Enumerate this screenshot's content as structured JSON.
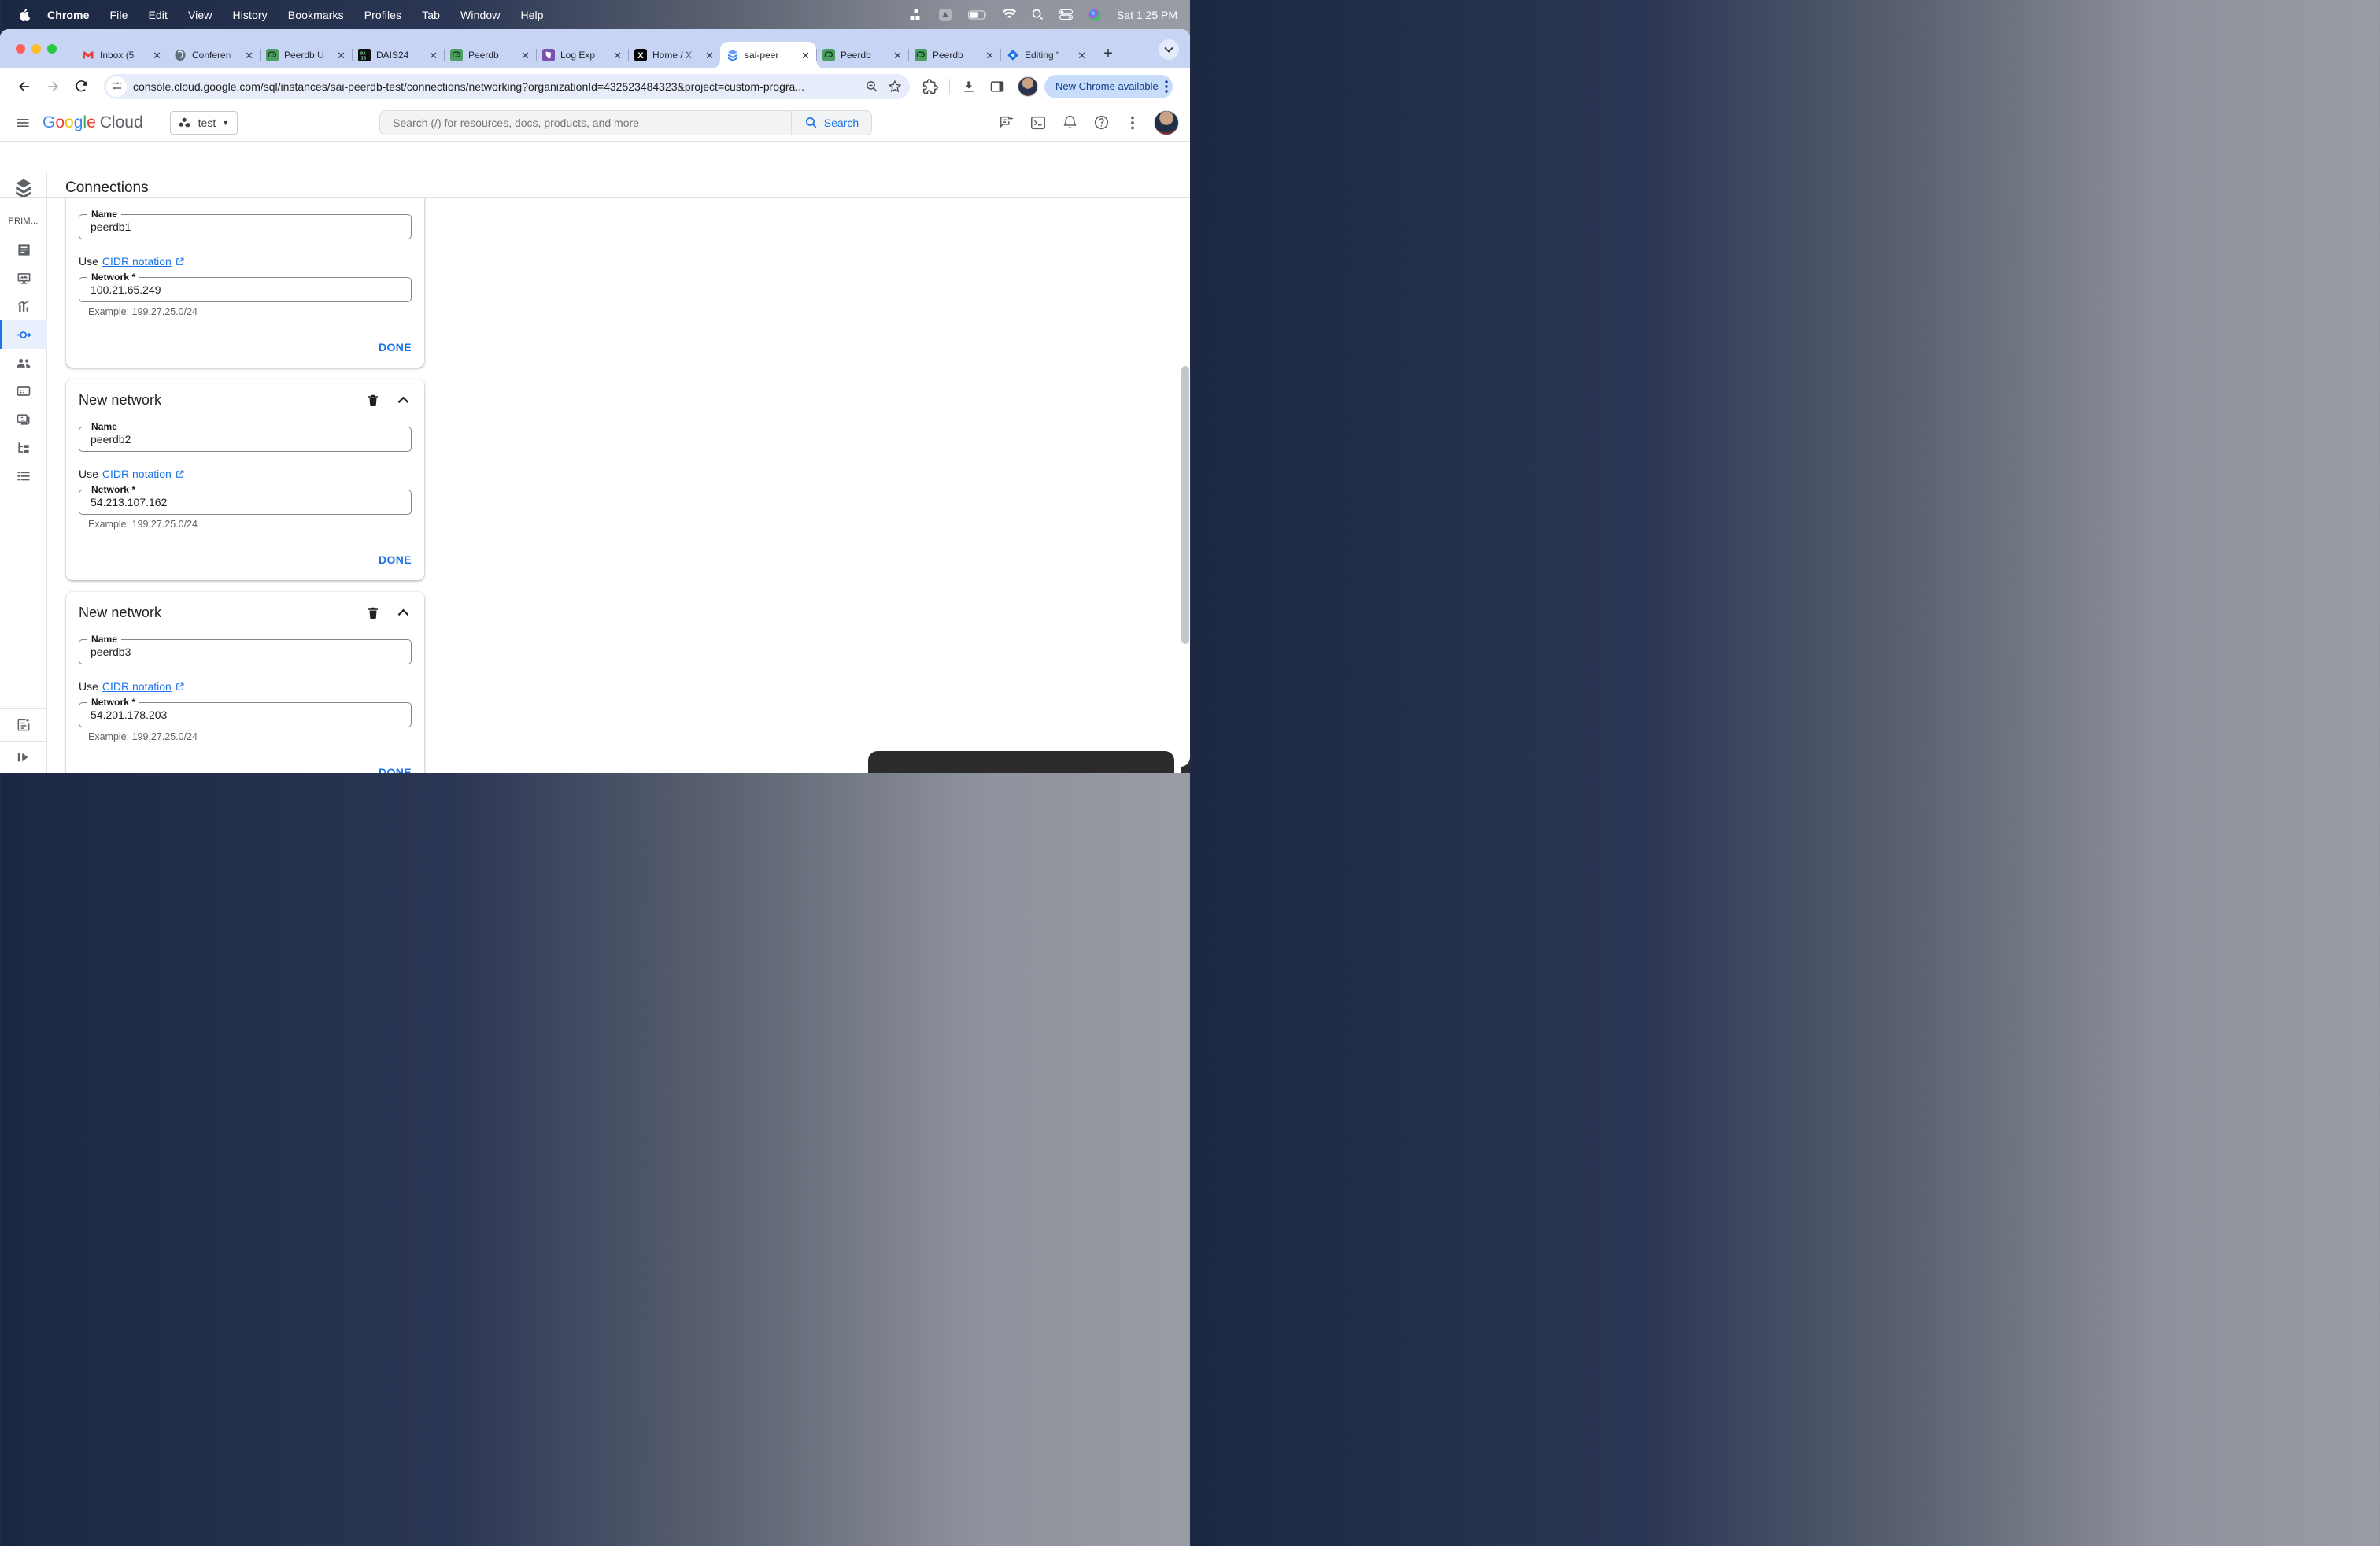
{
  "menubar": {
    "items": [
      "Chrome",
      "File",
      "Edit",
      "View",
      "History",
      "Bookmarks",
      "Profiles",
      "Tab",
      "Window",
      "Help"
    ],
    "clock": "Sat 1:25 PM"
  },
  "tabs": [
    {
      "title": "Inbox (5",
      "icon": "gmail"
    },
    {
      "title": "Conferen",
      "icon": "postgres"
    },
    {
      "title": "Peerdb U",
      "icon": "peerdb"
    },
    {
      "title": "DAIS24",
      "icon": "dais"
    },
    {
      "title": "Peerdb",
      "icon": "peerdb"
    },
    {
      "title": "Log Exp",
      "icon": "datadog"
    },
    {
      "title": "Home / X",
      "icon": "x"
    },
    {
      "title": "sai-peer",
      "icon": "cloudsql",
      "active": true
    },
    {
      "title": "Peerdb",
      "icon": "peerdb"
    },
    {
      "title": "Peerdb",
      "icon": "peerdb"
    },
    {
      "title": "Editing \"",
      "icon": "mymaps"
    }
  ],
  "toolbar": {
    "url": "console.cloud.google.com/sql/instances/sai-peerdb-test/connections/networking?organizationId=432523484323&project=custom-progra...",
    "update_label": "New Chrome available"
  },
  "cloud_header": {
    "logo_google": "Google",
    "logo_cloud": "Cloud",
    "project_name": "test",
    "search_placeholder": "Search (/) for resources, docs, products, and more",
    "search_button": "Search"
  },
  "sidebar": {
    "section_label": "PRIM..."
  },
  "page": {
    "title": "Connections"
  },
  "cards": [
    {
      "name_label": "Name",
      "name_value": "peerdb1",
      "use_text": "Use",
      "cidr_link": "CIDR notation",
      "network_label": "Network *",
      "network_value": "100.21.65.249",
      "example": "Example: 199.27.25.0/24",
      "done": "DONE"
    },
    {
      "header": "New network",
      "name_label": "Name",
      "name_value": "peerdb2",
      "use_text": "Use",
      "cidr_link": "CIDR notation",
      "network_label": "Network *",
      "network_value": "54.213.107.162",
      "example": "Example: 199.27.25.0/24",
      "done": "DONE"
    },
    {
      "header": "New network",
      "name_label": "Name",
      "name_value": "peerdb3",
      "use_text": "Use",
      "cidr_link": "CIDR notation",
      "network_label": "Network *",
      "network_value": "54.201.178.203",
      "example": "Example: 199.27.25.0/24",
      "done": "DONE"
    }
  ],
  "colors": {
    "accent": "#1a73e8",
    "active_nav_bg": "#e8f0fe",
    "tabstrip": "#c8d4f4",
    "update_pill_bg": "#c8dcfb",
    "update_pill_text": "#123c87"
  }
}
